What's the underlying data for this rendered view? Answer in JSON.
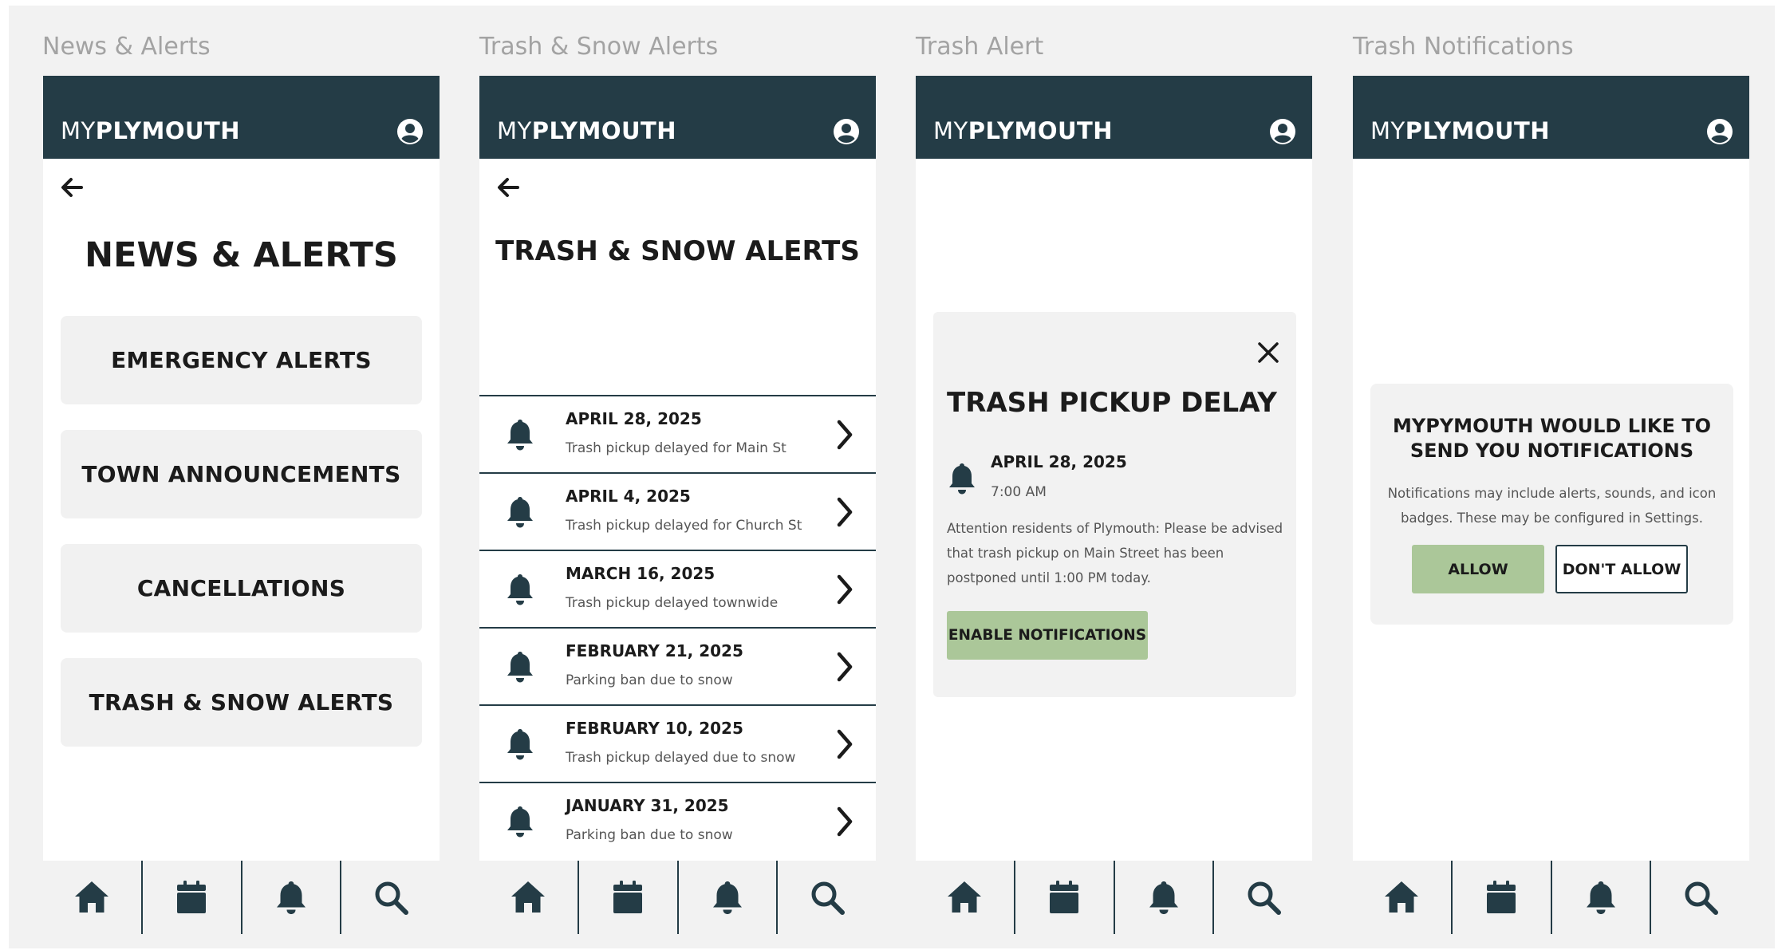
{
  "app": {
    "logo_light": "MY",
    "logo_bold": "PLYMOUTH"
  },
  "frames": [
    {
      "label": "News & Alerts",
      "title": "NEWS & ALERTS",
      "buttons": [
        "EMERGENCY ALERTS",
        "TOWN ANNOUNCEMENTS",
        "CANCELLATIONS",
        "TRASH & SNOW ALERTS"
      ]
    },
    {
      "label": "Trash & Snow Alerts",
      "title": "TRASH & SNOW ALERTS",
      "alerts": [
        {
          "date": "APRIL 28, 2025",
          "description": "Trash pickup delayed for Main St"
        },
        {
          "date": "APRIL 4, 2025",
          "description": "Trash pickup delayed for Church St"
        },
        {
          "date": "MARCH 16, 2025",
          "description": "Trash pickup delayed townwide"
        },
        {
          "date": "FEBRUARY 21, 2025",
          "description": "Parking ban due to snow"
        },
        {
          "date": "FEBRUARY 10, 2025",
          "description": "Trash pickup delayed due to snow"
        },
        {
          "date": "JANUARY 31, 2025",
          "description": "Parking ban due to snow"
        }
      ]
    },
    {
      "label": "Trash Alert",
      "modal": {
        "title": "TRASH PICKUP DELAY",
        "date": "APRIL 28, 2025",
        "time": "7:00 AM",
        "body": "Attention residents of Plymouth: Please be advised that trash pickup on Main Street has been postponed until 1:00 PM today.",
        "button": "ENABLE NOTIFICATIONS"
      }
    },
    {
      "label": "Trash Notifications",
      "dialog": {
        "title": "MYPYMOUTH WOULD LIKE TO SEND YOU NOTIFICATIONS",
        "body": "Notifications may include alerts, sounds, and icon badges. These may be configured in Settings.",
        "allow": "ALLOW",
        "deny": "DON'T ALLOW"
      }
    }
  ],
  "tabbar": [
    "home-icon",
    "calendar-icon",
    "bell-icon",
    "search-icon"
  ],
  "colors": {
    "header": "#243c46",
    "accent_green": "#abc799",
    "card": "#f1f1f1",
    "canvas": "#f2f2f2"
  }
}
